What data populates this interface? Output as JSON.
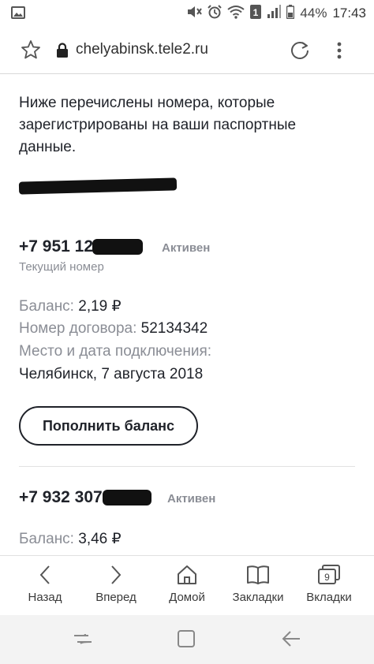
{
  "status_bar": {
    "battery": "44%",
    "time": "17:43"
  },
  "address_bar": {
    "url": "chelyabinsk.tele2.ru"
  },
  "content": {
    "intro": "Ниже перечислены номера, которые зарегистрированы на ваши паспортные данные.",
    "numbers": [
      {
        "phone": "+7 951 127-",
        "status": "Активен",
        "current_label": "Текущий номер",
        "balance_label": "Баланс:",
        "balance_value": "2,19 ₽",
        "contract_label": "Номер договора:",
        "contract_value": "52134342",
        "place_date_label": "Место и дата подключения:",
        "place_date_value": "Челябинск, 7 августа 2018",
        "topup_button": "Пополнить баланс"
      },
      {
        "phone": "+7 932 307-",
        "status": "Активен",
        "balance_label": "Баланс:",
        "balance_value": "3,46 ₽"
      }
    ]
  },
  "toolbar": {
    "items": [
      {
        "label": "Назад",
        "icon": "chevron-left-icon"
      },
      {
        "label": "Вперед",
        "icon": "chevron-right-icon"
      },
      {
        "label": "Домой",
        "icon": "home-icon"
      },
      {
        "label": "Закладки",
        "icon": "book-icon"
      },
      {
        "label": "Вкладки",
        "icon": "tabs-icon",
        "badge": "9"
      }
    ]
  }
}
